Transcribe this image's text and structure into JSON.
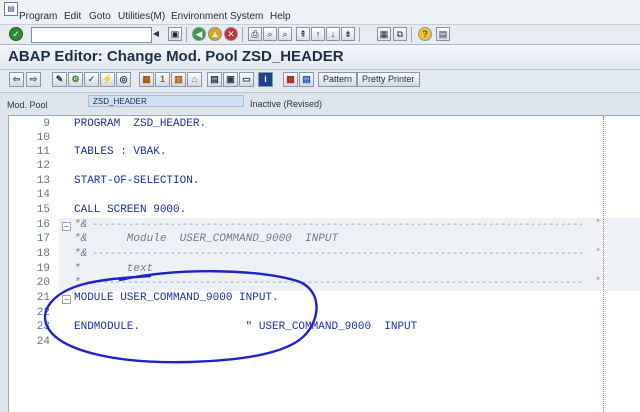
{
  "menu": {
    "items": [
      {
        "label": "Program"
      },
      {
        "label": "Edit"
      },
      {
        "label": "Goto"
      },
      {
        "label": "Utilities(M)"
      },
      {
        "label": "Environment"
      },
      {
        "label": "System"
      },
      {
        "label": "Help"
      }
    ]
  },
  "toolbar": {
    "command_field_value": "",
    "icons": [
      "enter",
      "back",
      "exit",
      "cancel",
      "print",
      "find",
      "find-next",
      "first-page",
      "prev-page",
      "next-page",
      "last-page",
      "create-session",
      "shortcut",
      "help",
      "customize"
    ]
  },
  "title": "ABAP Editor: Change Mod. Pool ZSD_HEADER",
  "app_toolbar": {
    "pattern_label": "Pattern",
    "pretty_printer_label": "Pretty Printer"
  },
  "info": {
    "type_label": "Mod. Pool",
    "program_name": "ZSD_HEADER",
    "status": "Inactive (Revised)"
  },
  "editor": {
    "lines": [
      {
        "num": "9",
        "text": "PROGRAM  ZSD_HEADER."
      },
      {
        "num": "10",
        "text": ""
      },
      {
        "num": "11",
        "text": "TABLES : VBAK."
      },
      {
        "num": "12",
        "text": ""
      },
      {
        "num": "13",
        "text": "START-OF-SELECTION."
      },
      {
        "num": "14",
        "text": ""
      },
      {
        "num": "15",
        "text": "CALL SCREEN 9000."
      },
      {
        "num": "16",
        "text": "*&"
      },
      {
        "num": "17",
        "text": "*&      Module  USER_COMMAND_9000  INPUT"
      },
      {
        "num": "18",
        "text": "*&"
      },
      {
        "num": "19",
        "text": "*       text"
      },
      {
        "num": "20",
        "text": "*"
      },
      {
        "num": "21",
        "text": "MODULE USER_COMMAND_9000 INPUT."
      },
      {
        "num": "22",
        "text": ""
      },
      {
        "num": "23",
        "text": "ENDMODULE.                \" USER_COMMAND_9000  INPUT"
      },
      {
        "num": "24",
        "text": ""
      }
    ]
  },
  "colors": {
    "code_text": "#1a2f9c",
    "comment_text": "#6e7b8a",
    "annotation_circle": "#1d22c9"
  }
}
